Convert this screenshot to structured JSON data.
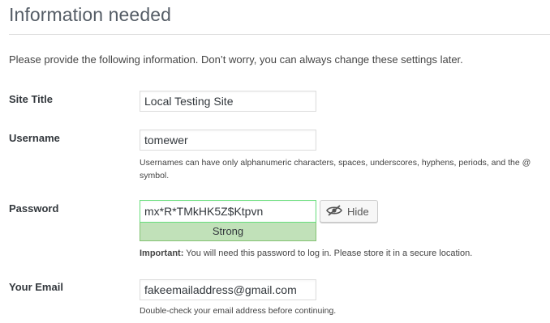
{
  "page": {
    "title": "Information needed",
    "intro": "Please provide the following information. Don’t worry, you can always change these settings later."
  },
  "fields": {
    "site_title": {
      "label": "Site Title",
      "value": "Local Testing Site"
    },
    "username": {
      "label": "Username",
      "value": "tomewer",
      "description": "Usernames can have only alphanumeric characters, spaces, underscores, hyphens, periods, and the @ symbol."
    },
    "password": {
      "label": "Password",
      "value": "mx*R*TMkHK5Z$Ktpvn",
      "hide_button_label": "Hide",
      "strength": "Strong",
      "important_prefix": "Important:",
      "important_text": " You will need this password to log in. Please store it in a secure location."
    },
    "email": {
      "label": "Your Email",
      "value": "fakeemailaddress@gmail.com",
      "description": "Double-check your email address before continuing."
    }
  },
  "icons": {
    "hide_button_icon": "eye-slash-icon"
  },
  "colors": {
    "strength_strong_bg": "#c1e1b9",
    "strength_strong_border": "#83c373",
    "password_field_border": "#68de7c"
  }
}
